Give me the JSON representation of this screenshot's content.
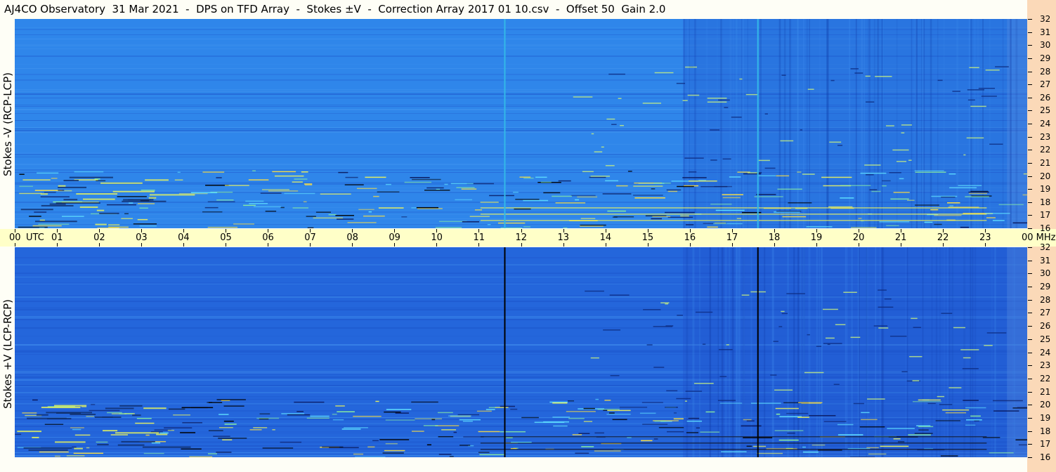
{
  "title": "AJ4CO Observatory  31 Mar 2021  -  DPS on TFD Array  -  Stokes ±V  -  Correction Array 2017 01 10.csv  -  Offset 50  Gain 2.0",
  "panels": {
    "top_label": "Stokes -V (RCP-LCP)",
    "bottom_label": "Stokes +V (LCP-RCP)"
  },
  "utc_axis": {
    "unit_label": "UTC",
    "end_label": "00 MHz",
    "ticks": [
      "00",
      "01",
      "02",
      "03",
      "04",
      "05",
      "06",
      "07",
      "08",
      "09",
      "10",
      "11",
      "12",
      "13",
      "14",
      "15",
      "16",
      "17",
      "18",
      "19",
      "20",
      "21",
      "22",
      "23"
    ]
  },
  "mhz_axis": {
    "ticks": [
      "32",
      "31",
      "30",
      "29",
      "28",
      "27",
      "26",
      "25",
      "24",
      "23",
      "22",
      "21",
      "20",
      "19",
      "18",
      "17",
      "16"
    ]
  },
  "chart_data": [
    {
      "type": "heatmap",
      "title": "AJ4CO Observatory  31 Mar 2021  -  DPS on TFD Array  -  Stokes ±V  -  Correction Array 2017 01 10.csv  -  Offset 50  Gain 2.0",
      "ylabel": "Stokes -V (RCP-LCP)",
      "x_unit": "UTC",
      "y_unit": "MHz",
      "xlim": [
        0,
        24
      ],
      "ylim": [
        16,
        32
      ],
      "colors": {
        "background": "#2f86ea",
        "marker_line": "#33b8e8"
      },
      "marker_lines_utc": [
        11.6,
        17.6
      ]
    },
    {
      "type": "heatmap",
      "ylabel": "Stokes +V (LCP-RCP)",
      "x_unit": "UTC",
      "y_unit": "MHz",
      "xlim": [
        0,
        24
      ],
      "ylim": [
        16,
        32
      ],
      "colors": {
        "background": "#2466db",
        "marker_line": "#000000"
      },
      "marker_lines_utc": [
        11.6,
        17.6
      ]
    }
  ]
}
